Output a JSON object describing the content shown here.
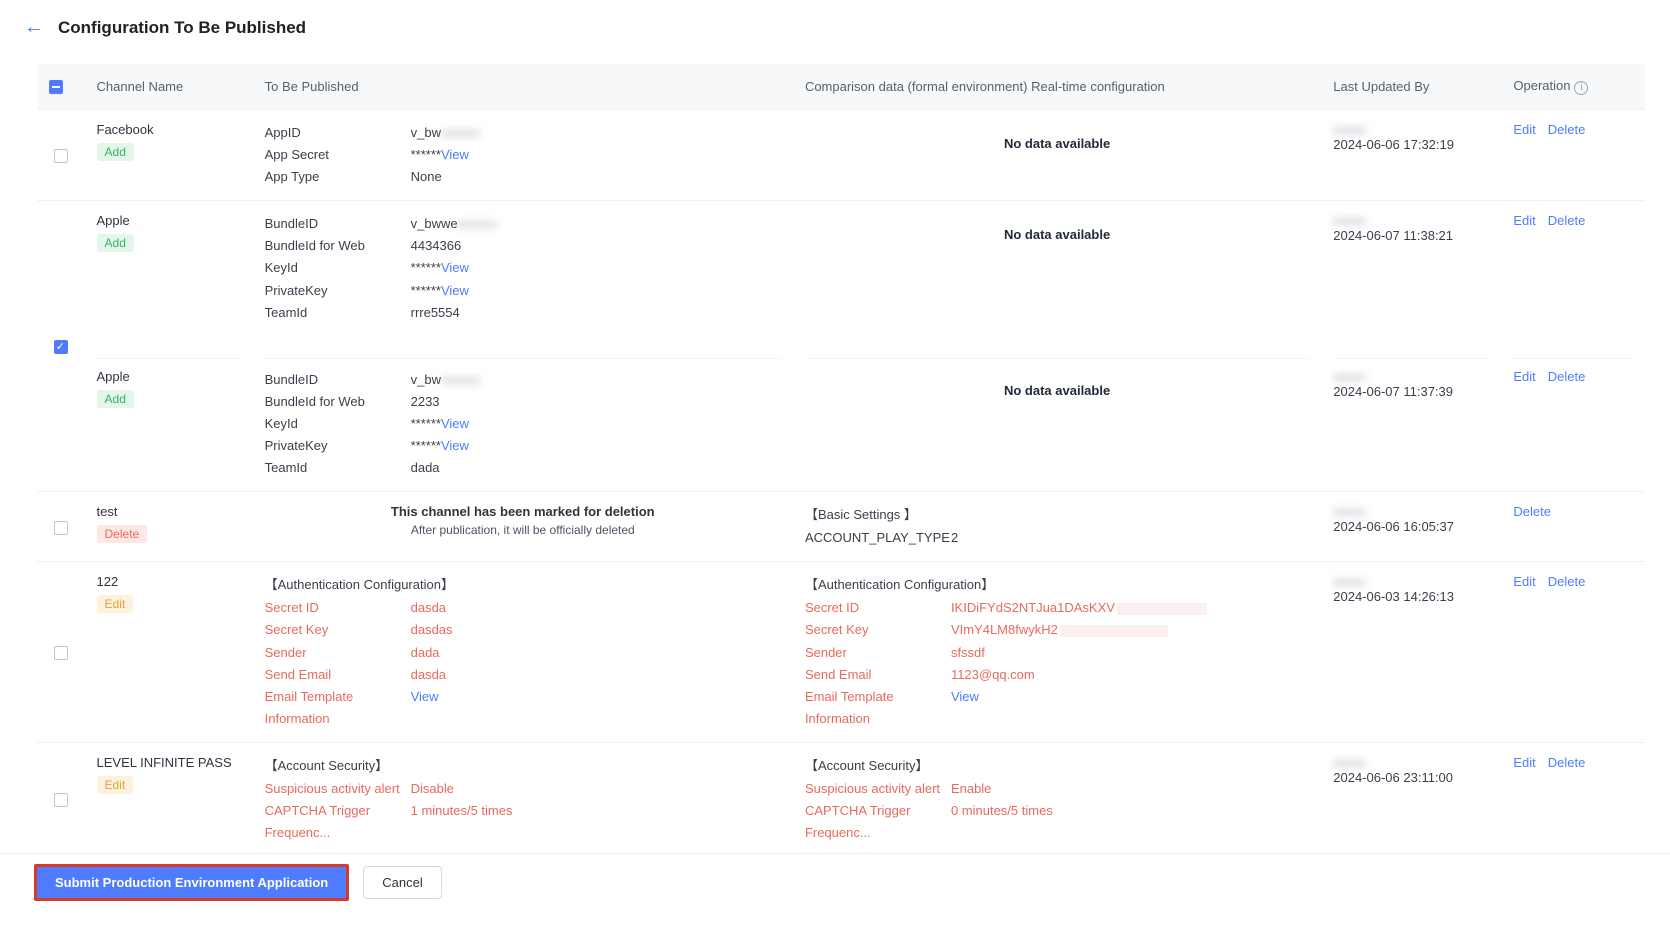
{
  "header": {
    "title": "Configuration To Be Published"
  },
  "columns": {
    "channel": "Channel Name",
    "publish": "To Be Published",
    "compare": "Comparison data (formal environment) Real-time configuration",
    "updated": "Last Updated By",
    "operation": "Operation"
  },
  "badges": {
    "add": "Add",
    "delete": "Delete",
    "edit": "Edit"
  },
  "labels": {
    "no_data": "No data available",
    "deleted_t1": "This channel has been marked for deletion",
    "deleted_t2": "After publication, it will be officially deleted",
    "view": "View",
    "edit": "Edit",
    "delete": "Delete"
  },
  "footer": {
    "submit": "Submit Production Environment Application",
    "cancel": "Cancel"
  },
  "rows": [
    {
      "channel": "Facebook",
      "badge": "add",
      "checked": false,
      "publish_kv": [
        {
          "k": "AppID",
          "v": "v_bw",
          "blurred_suffix": true
        },
        {
          "k": "App Secret",
          "v_secret": "******",
          "view": true
        },
        {
          "k": "App Type",
          "v": "None"
        }
      ],
      "compare_no_data": true,
      "updated_by_blurred": "xxxxx",
      "updated_time": "2024-06-06 17:32:19",
      "ops": [
        "edit",
        "delete"
      ]
    },
    {
      "channel": "Apple",
      "badge": "add",
      "checked": true,
      "publish_kv": [
        {
          "k": "BundleID",
          "v": "v_bwwe",
          "blurred_suffix": true
        },
        {
          "k": "BundleId for Web",
          "v": "4434366"
        },
        {
          "k": "KeyId",
          "v_secret": "******",
          "view": true
        },
        {
          "k": "PrivateKey",
          "v_secret": "******",
          "view": true
        },
        {
          "k": "TeamId",
          "v": "rrre5554"
        }
      ],
      "compare_no_data": true,
      "updated_by_blurred": "xxxxx",
      "updated_time": "2024-06-07 11:38:21",
      "ops": [
        "edit",
        "delete"
      ],
      "subrow": {
        "channel": "Apple",
        "badge": "add",
        "publish_kv": [
          {
            "k": "BundleID",
            "v": "v_bw",
            "blurred_suffix": true
          },
          {
            "k": "BundleId for Web",
            "v": "2233"
          },
          {
            "k": "KeyId",
            "v_secret": "******",
            "view": true
          },
          {
            "k": "PrivateKey",
            "v_secret": "******",
            "view": true
          },
          {
            "k": "TeamId",
            "v": "dada"
          }
        ],
        "compare_no_data": true,
        "updated_by_blurred": "xxxxx",
        "updated_time": "2024-06-07 11:37:39",
        "ops": [
          "edit",
          "delete"
        ]
      }
    },
    {
      "channel": "test",
      "badge": "delete",
      "checked": false,
      "deleted": true,
      "compare_section": {
        "title": "【Basic Settings 】",
        "kv": [
          {
            "k": "ACCOUNT_PLAY_TYPE",
            "v": "2"
          }
        ]
      },
      "updated_by_blurred": "xxxxx",
      "updated_time": "2024-06-06 16:05:37",
      "ops": [
        "delete"
      ]
    },
    {
      "channel": "122",
      "badge": "edit",
      "checked": false,
      "publish_section_title": "【Authentication Configuration】",
      "publish_kv": [
        {
          "k": "Secret ID",
          "v": "dasda",
          "diff": true
        },
        {
          "k": "Secret Key",
          "v": "dasdas",
          "diff": true
        },
        {
          "k": "Sender",
          "v": "dada",
          "diff": true
        },
        {
          "k": "Send Email",
          "v": "dasda",
          "diff": true
        },
        {
          "k": "Email Template Information",
          "view": true,
          "diff": true
        }
      ],
      "compare_section_title": "【Authentication Configuration】",
      "compare_kv": [
        {
          "k": "Secret ID",
          "v": "IKIDiFYdS2NTJua1DAsKXV",
          "diff": true,
          "highlight_tail": 90
        },
        {
          "k": "Secret Key",
          "v": "VImY4LM8fwykH2",
          "diff": true,
          "highlight_tail": 108
        },
        {
          "k": "Sender",
          "v": "sfssdf",
          "diff": true
        },
        {
          "k": "Send Email",
          "v": "1123@qq.com",
          "diff": true
        },
        {
          "k": "Email Template Information",
          "view": true,
          "diff": true
        }
      ],
      "updated_by_blurred": "xxxxx",
      "updated_time": "2024-06-03 14:26:13",
      "ops": [
        "edit",
        "delete"
      ]
    },
    {
      "channel": "LEVEL INFINITE PASS",
      "badge": "edit",
      "checked": false,
      "publish_section_title": "【Account Security】",
      "publish_kv": [
        {
          "k": "Suspicious activity alert",
          "v": "Disable",
          "diff": true
        },
        {
          "k": "CAPTCHA Trigger Frequenc...",
          "v": "1 minutes/5 times",
          "diff": true
        }
      ],
      "compare_section_title": "【Account Security】",
      "compare_kv": [
        {
          "k": "Suspicious activity alert",
          "v": "Enable",
          "diff": true
        },
        {
          "k": "CAPTCHA Trigger Frequenc...",
          "v": "0 minutes/5 times",
          "diff": true
        }
      ],
      "updated_by_blurred": "xxxxx",
      "updated_time": "2024-06-06 23:11:00",
      "ops": [
        "edit",
        "delete"
      ]
    }
  ]
}
